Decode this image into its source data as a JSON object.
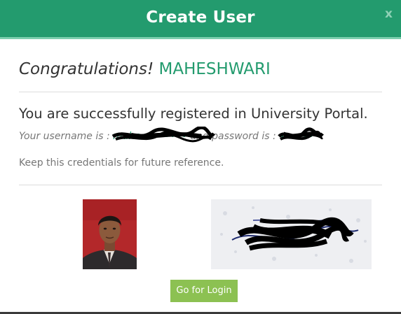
{
  "header": {
    "title": "Create User",
    "close_label": "x",
    "color": "#239b6e"
  },
  "body": {
    "greeting_lead": "Congratulations!",
    "user_name": "MAHESHWARI",
    "success_message": "You are successfully registered in University Portal.",
    "username_prefix": "Your username is :",
    "username_value": "mahe••••••••",
    "password_prefix": "and password is :",
    "password_value": "••••••",
    "keep_message": "Keep this credentials for future reference."
  },
  "images": {
    "photo_icon": "user-photo",
    "signature_icon": "signature-image"
  },
  "footer": {
    "login_label": "Go for Login",
    "login_color": "#8cc152"
  }
}
